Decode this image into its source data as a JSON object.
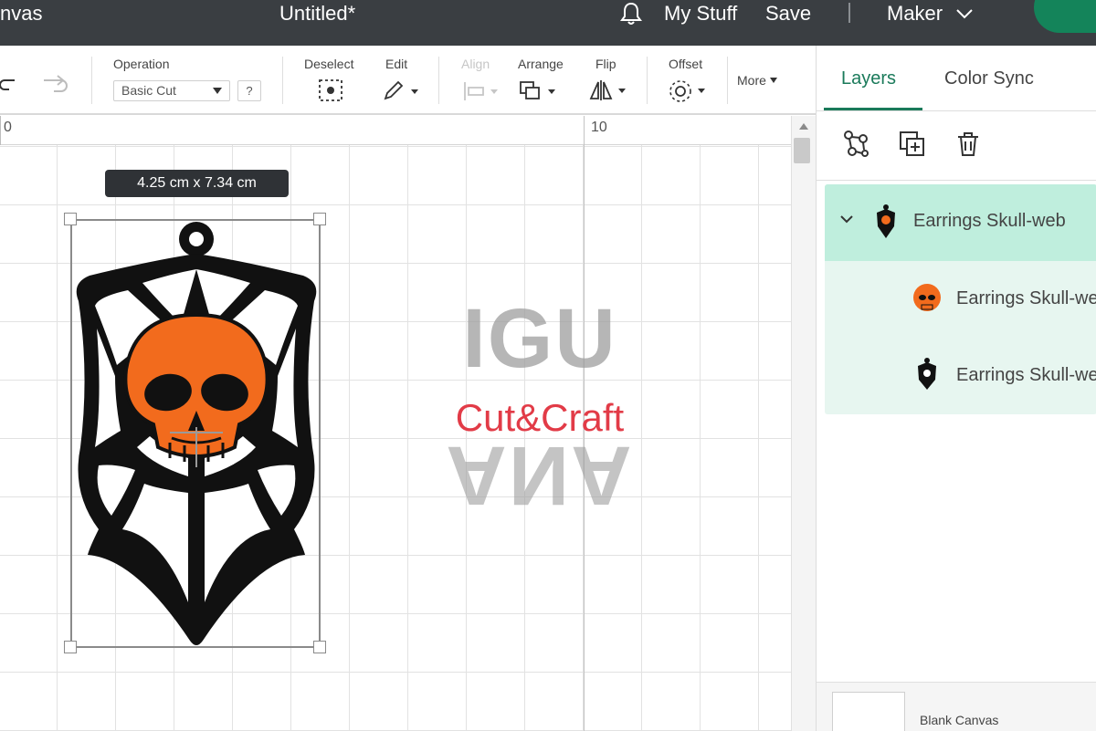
{
  "header": {
    "back_label": "nvas",
    "doc_title": "Untitled*",
    "my_stuff": "My Stuff",
    "save": "Save",
    "machine": "Maker"
  },
  "toolbar": {
    "operation_label": "Operation",
    "operation_value": "Basic Cut",
    "help": "?",
    "deselect": "Deselect",
    "edit": "Edit",
    "align": "Align",
    "arrange": "Arrange",
    "flip": "Flip",
    "offset": "Offset",
    "more": "More"
  },
  "ruler": {
    "marks": [
      "0",
      "10"
    ]
  },
  "canvas": {
    "dimensions": "4.25  cm x 7.34  cm",
    "watermark_top": "IGU",
    "watermark_mid": "Cut&Craft",
    "watermark_bot": "ANA"
  },
  "panel": {
    "tabs": {
      "layers": "Layers",
      "color_sync": "Color Sync"
    },
    "group_name": "Earrings Skull-web",
    "children": [
      {
        "name": "Earrings Skull-web",
        "color": "#f26b1d"
      },
      {
        "name": "Earrings Skull-web",
        "color": "#111111"
      }
    ],
    "blank_canvas": "Blank Canvas"
  },
  "colors": {
    "accent": "#1a7a5a",
    "header_bg": "#3a3e42",
    "skull": "#f26b1d",
    "web": "#111111",
    "watermark_red": "#e23b47"
  }
}
